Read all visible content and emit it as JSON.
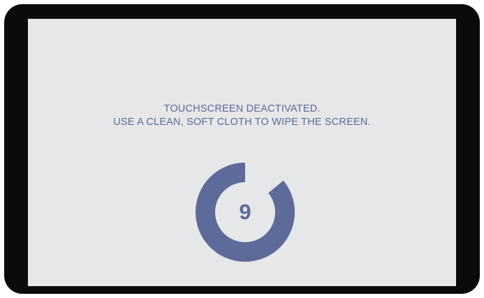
{
  "screen": {
    "message_line1": "TOUCHSCREEN DEACTIVATED.",
    "message_line2": "USE A CLEAN, SOFT CLOTH TO WIPE THE SCREEN."
  },
  "countdown": {
    "value": "9",
    "progress_fraction": 0.86
  },
  "colors": {
    "bezel": "#0b0b0b",
    "screen_background": "#e6e7e8",
    "accent": "#5e6a99"
  }
}
